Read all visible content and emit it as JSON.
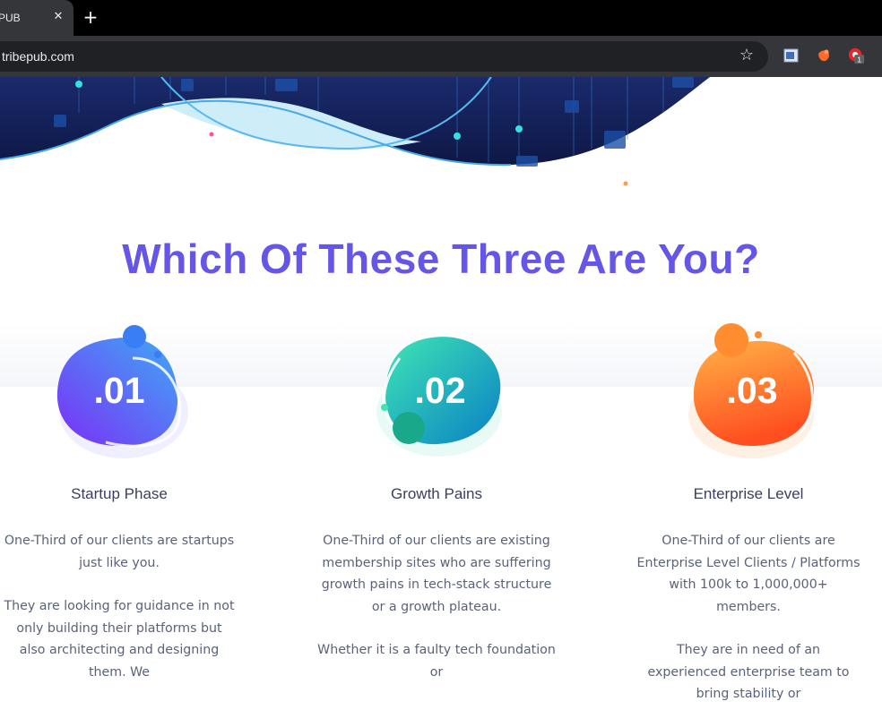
{
  "browser": {
    "tab_title": "PUB",
    "tab_close": "✕",
    "new_tab": "+",
    "url": "tribepub.com",
    "extension_badge": "1"
  },
  "section": {
    "title": "Which Of These Three Are You?"
  },
  "tiers": [
    {
      "number": ".01",
      "title": "Startup Phase",
      "paragraphs": [
        "One-Third of our clients are startups just like you.",
        "They are looking for guidance in not only building their platforms but also architecting and designing them. We"
      ]
    },
    {
      "number": ".02",
      "title": "Growth Pains",
      "paragraphs": [
        "One-Third of our clients are existing membership sites who are suffering growth pains in tech-stack structure or a growth plateau.",
        "Whether it is a faulty tech foundation or"
      ]
    },
    {
      "number": ".03",
      "title": "Enterprise Level",
      "paragraphs": [
        "One-Third of our clients are Enterprise Level Clients / Platforms with 100k to 1,000,000+ members.",
        "They are in need of an experienced enterprise team to bring stability or"
      ]
    }
  ],
  "colors": {
    "title": "#6556e8",
    "hero_bg": "#0f1a4a",
    "badge1_start": "#7b2ff7",
    "badge1_end": "#3fa9f5",
    "badge2_start": "#3ee6b5",
    "badge2_end": "#0a7fc4",
    "badge3_start": "#ffb347",
    "badge3_end": "#ff4e1f"
  }
}
